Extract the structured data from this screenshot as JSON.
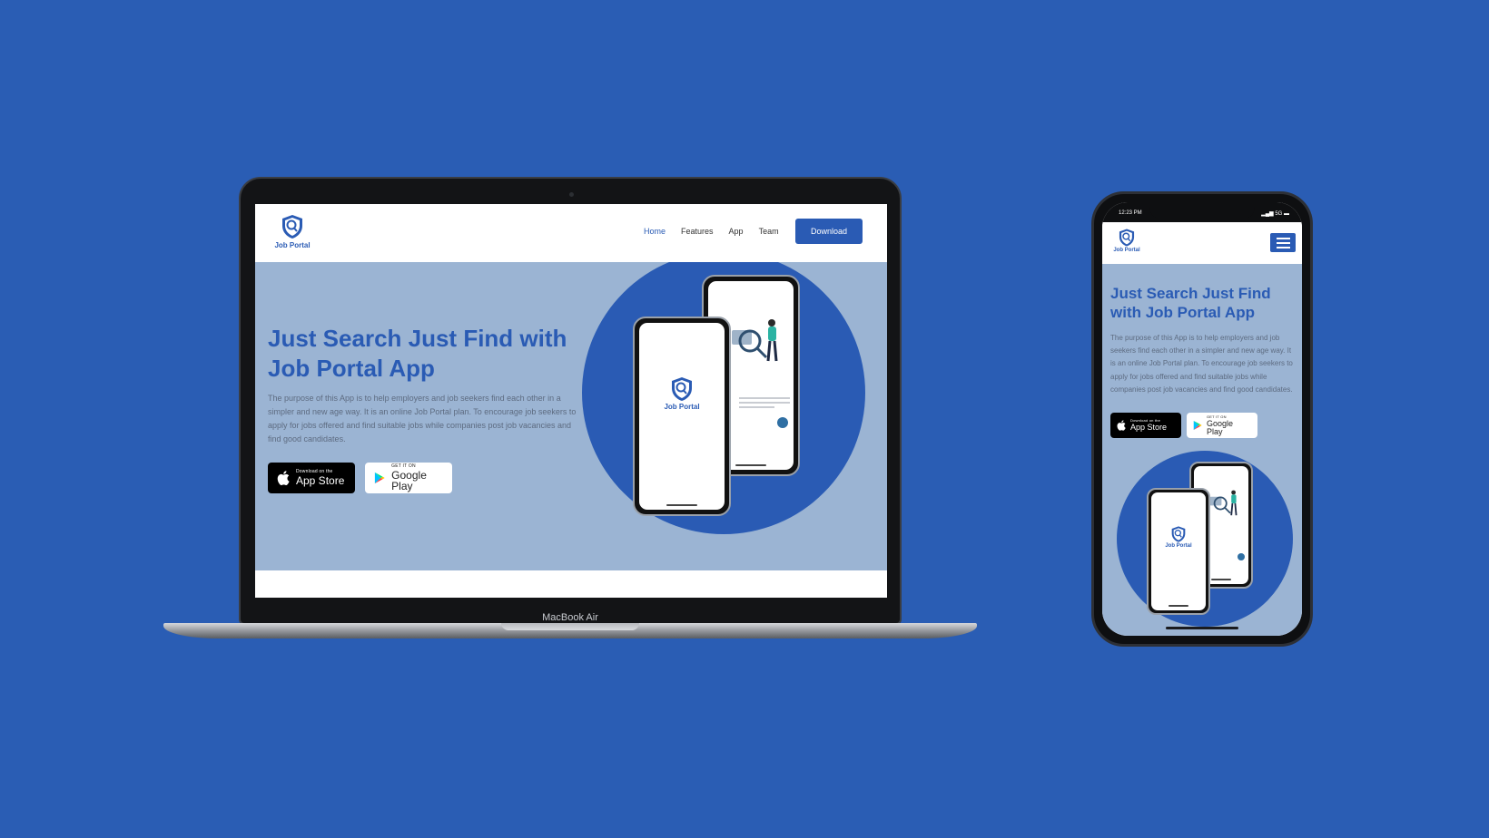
{
  "colors": {
    "background": "#2a5db4",
    "brand": "#2a5bb4",
    "hero_bg": "#9bb4d3"
  },
  "brand": {
    "name": "Job Portal",
    "logo_icon": "shield-magnifier-icon"
  },
  "laptop": {
    "label": "MacBook Air",
    "nav": {
      "links": [
        {
          "label": "Home",
          "active": true
        },
        {
          "label": "Features",
          "active": false
        },
        {
          "label": "App",
          "active": false
        },
        {
          "label": "Team",
          "active": false
        }
      ],
      "cta_label": "Download"
    }
  },
  "hero": {
    "title": "Just Search Just Find with Job Portal App",
    "description": "The purpose of this App is to help employers and job seekers find each other in a simpler and new age way. It is an online Job Portal plan. To encourage job seekers to apply for jobs offered and find suitable jobs while companies post job vacancies and find good candidates."
  },
  "store_badges": {
    "apple": {
      "small": "Download on the",
      "big": "App Store",
      "icon": "apple-icon"
    },
    "google": {
      "small": "GET IT ON",
      "big": "Google Play",
      "icon": "google-play-icon"
    }
  },
  "mobile": {
    "status": {
      "time": "12:23 PM",
      "signal": "5G"
    },
    "menu_icon": "hamburger-menu-icon"
  }
}
